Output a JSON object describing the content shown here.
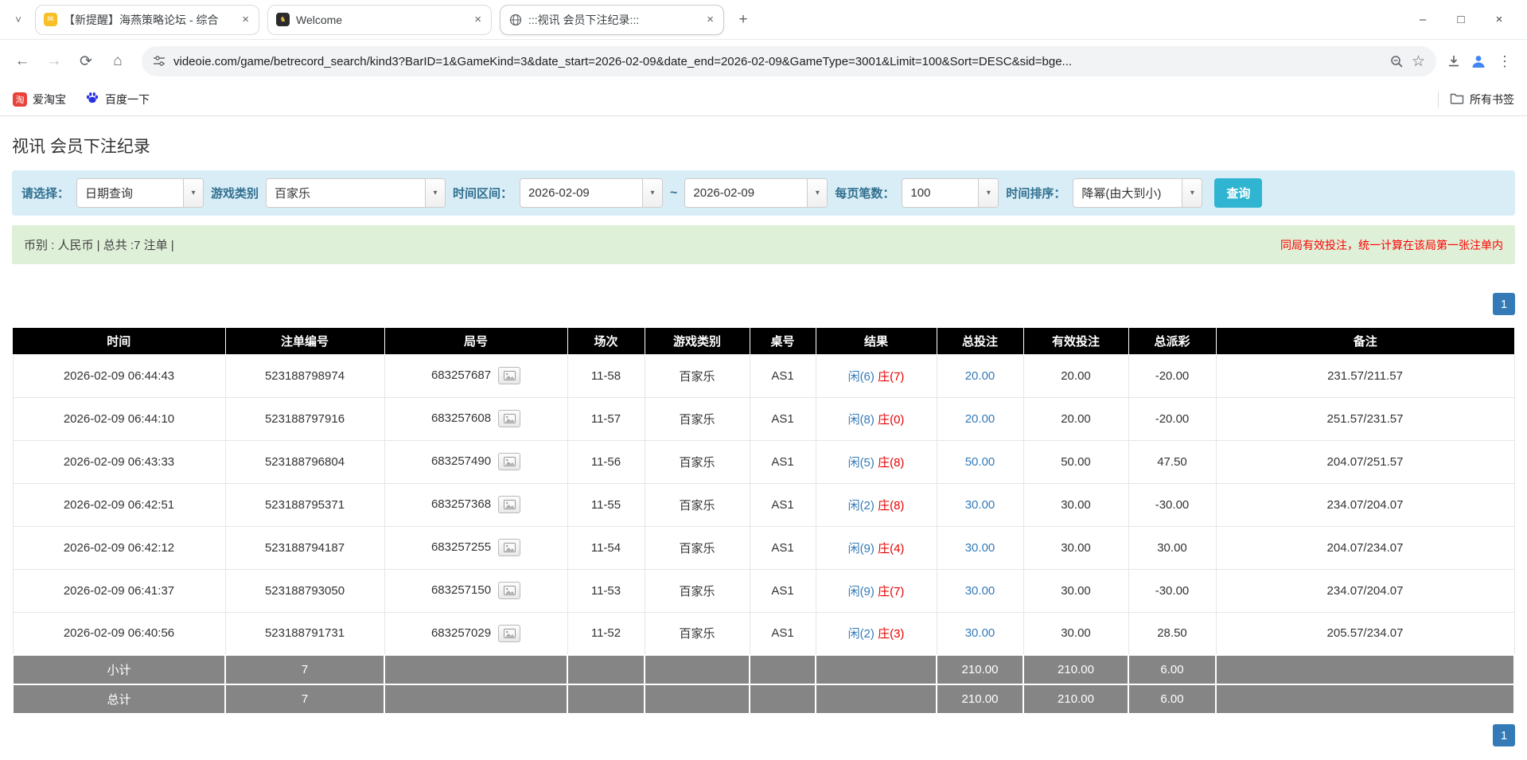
{
  "icons": {
    "tab_search": "˅",
    "close": "×",
    "new_tab": "+",
    "minimize": "–",
    "maximize": "□",
    "back": "←",
    "forward": "→",
    "reload": "⟳",
    "home": "⌂",
    "star": "☆",
    "menu": "⋮",
    "dropdown": "▾",
    "taobao_glyph": "淘",
    "welcome_glyph": "♞",
    "mail_glyph": "✉"
  },
  "browser": {
    "tabs": [
      {
        "title": "【新提醒】海燕策略论坛 - 综合"
      },
      {
        "title": "Welcome"
      },
      {
        "title": ":::视讯 会员下注纪录:::"
      }
    ],
    "url": "videoie.com/game/betrecord_search/kind3?BarID=1&GameKind=3&date_start=2026-02-09&date_end=2026-02-09&GameType=3001&Limit=100&Sort=DESC&sid=bge...",
    "bookmarks": {
      "item1": "爱淘宝",
      "item2": "百度一下",
      "all_bookmarks": "所有书签"
    }
  },
  "page": {
    "title": "视讯 会员下注纪录",
    "filters": {
      "select_label": "请选择：",
      "select_value": "日期查询",
      "game_label": "游戏类别",
      "game_value": "百家乐",
      "range_label": "时间区间：",
      "date_start": "2026-02-09",
      "tilde": "~",
      "date_end": "2026-02-09",
      "per_page_label": "每页笔数：",
      "per_page_value": "100",
      "sort_label": "时间排序：",
      "sort_value": "降幂(由大到小)",
      "search_button": "查询"
    },
    "summary": {
      "left": "币别 : 人民币 | 总共 :7 注单 |",
      "right": "同局有效投注，统一计算在该局第一张注单内"
    },
    "pagination": {
      "page": "1"
    },
    "table": {
      "headers": [
        "时间",
        "注单编号",
        "局号",
        "场次",
        "游戏类别",
        "桌号",
        "结果",
        "总投注",
        "有效投注",
        "总派彩",
        "备注"
      ],
      "rows": [
        {
          "time": "2026-02-09 06:44:43",
          "bet_id": "523188798974",
          "round": "683257687",
          "session": "11-58",
          "game": "百家乐",
          "table_no": "AS1",
          "result_player": "闲(6)",
          "result_banker": "庄(7)",
          "total_bet": "20.00",
          "valid_bet": "20.00",
          "payout": "-20.00",
          "remark": "231.57/211.57"
        },
        {
          "time": "2026-02-09 06:44:10",
          "bet_id": "523188797916",
          "round": "683257608",
          "session": "11-57",
          "game": "百家乐",
          "table_no": "AS1",
          "result_player": "闲(8)",
          "result_banker": "庄(0)",
          "total_bet": "20.00",
          "valid_bet": "20.00",
          "payout": "-20.00",
          "remark": "251.57/231.57"
        },
        {
          "time": "2026-02-09 06:43:33",
          "bet_id": "523188796804",
          "round": "683257490",
          "session": "11-56",
          "game": "百家乐",
          "table_no": "AS1",
          "result_player": "闲(5)",
          "result_banker": "庄(8)",
          "total_bet": "50.00",
          "valid_bet": "50.00",
          "payout": "47.50",
          "remark": "204.07/251.57"
        },
        {
          "time": "2026-02-09 06:42:51",
          "bet_id": "523188795371",
          "round": "683257368",
          "session": "11-55",
          "game": "百家乐",
          "table_no": "AS1",
          "result_player": "闲(2)",
          "result_banker": "庄(8)",
          "total_bet": "30.00",
          "valid_bet": "30.00",
          "payout": "-30.00",
          "remark": "234.07/204.07"
        },
        {
          "time": "2026-02-09 06:42:12",
          "bet_id": "523188794187",
          "round": "683257255",
          "session": "11-54",
          "game": "百家乐",
          "table_no": "AS1",
          "result_player": "闲(9)",
          "result_banker": "庄(4)",
          "total_bet": "30.00",
          "valid_bet": "30.00",
          "payout": "30.00",
          "remark": "204.07/234.07"
        },
        {
          "time": "2026-02-09 06:41:37",
          "bet_id": "523188793050",
          "round": "683257150",
          "session": "11-53",
          "game": "百家乐",
          "table_no": "AS1",
          "result_player": "闲(9)",
          "result_banker": "庄(7)",
          "total_bet": "30.00",
          "valid_bet": "30.00",
          "payout": "-30.00",
          "remark": "234.07/204.07"
        },
        {
          "time": "2026-02-09 06:40:56",
          "bet_id": "523188791731",
          "round": "683257029",
          "session": "11-52",
          "game": "百家乐",
          "table_no": "AS1",
          "result_player": "闲(2)",
          "result_banker": "庄(3)",
          "total_bet": "30.00",
          "valid_bet": "30.00",
          "payout": "28.50",
          "remark": "205.57/234.07"
        }
      ],
      "footer": [
        {
          "label": "小计",
          "count": "7",
          "total_bet": "210.00",
          "valid_bet": "210.00",
          "payout": "6.00"
        },
        {
          "label": "总计",
          "count": "7",
          "total_bet": "210.00",
          "valid_bet": "210.00",
          "payout": "6.00"
        }
      ]
    }
  }
}
